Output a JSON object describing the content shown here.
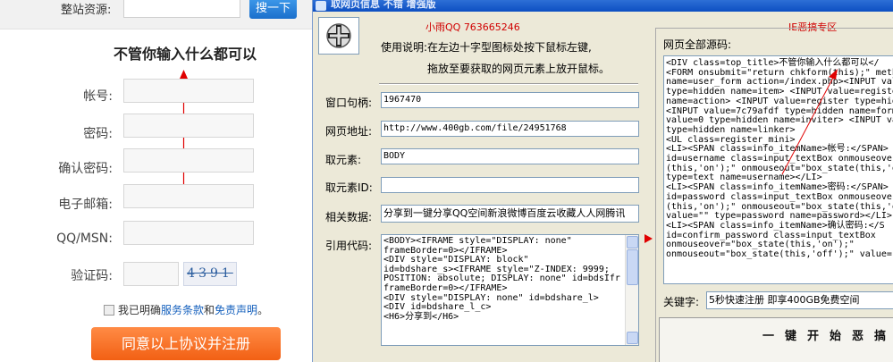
{
  "register_page": {
    "site_resource_label": "整站资源:",
    "search_button": "搜一下",
    "title": "不管你输入什么都可以",
    "fields": [
      {
        "label": "帐号:"
      },
      {
        "label": "密码:"
      },
      {
        "label": "确认密码:"
      },
      {
        "label": "电子邮箱:"
      },
      {
        "label": "QQ/MSN:"
      },
      {
        "label": "验证码:"
      }
    ],
    "captcha": "4391",
    "agree_prefix": "我已明确",
    "agree_terms": "服务条款",
    "agree_and": "和",
    "agree_disclaimer": "免责声明",
    "agree_end": "。",
    "submit": "同意以上协议并注册"
  },
  "tool": {
    "title": "取网页信息 不错 增强版",
    "qq_header": "小雨QQ  763665246",
    "ie_header": "IE恶搞专区",
    "usage_line1": "使用说明:在左边十字型图标处按下鼠标左键,",
    "usage_line2": "拖放至要获取的网页元素上放开鼠标。",
    "window_handle_label": "窗口句柄:",
    "window_handle_value": "1967470",
    "url_label": "网页地址:",
    "url_value": "http://www.400gb.com/file/24951768",
    "element_label": "取元素:",
    "element_value": "BODY",
    "element_id_label": "取元素ID:",
    "element_id_value": "",
    "related_label": "相关数据:",
    "related_value": "分享到一键分享QQ空间新浪微博百度云收藏人人网腾讯",
    "ref_code_label": "引用代码:",
    "ref_code": "<BODY><IFRAME style=\"DISPLAY: none\"\nframeBorder=0></IFRAME>\n<DIV style=\"DISPLAY: block\"\nid=bdshare_s><IFRAME style=\"Z-INDEX: 9999;\nPOSITION: absolute; DISPLAY: none\" id=bdsIfr\nframeBorder=0></IFRAME>\n<DIV style=\"DISPLAY: none\" id=bdshare_l>\n<DIV id=bdshare_l_c>\n<H6>分享到</H6>",
    "source_label": "网页全部源码:",
    "source_code": "<DIV class=top_title>不管你输入什么都可以</\n<FORM onsubmit=\"return chkform(this);\" meth\nname=user_form action=/index.php><INPUT val\ntype=hidden name=item> <INPUT value=registe\nname=action> <INPUT value=register type=hid\n<INPUT value=7c79afdf type=hidden name=form\nvalue=0 type=hidden name=inviter> <INPUT va\ntype=hidden name=linker>\n<UL class=register_mini>\n<LI><SPAN class=info_itemName>帐号:</SPAN>\nid=username class=input_textBox onmouseover\n(this,'on');\" onmouseout=\"box_state(this,'o\ntype=text name=username></LI>\n<LI><SPAN class=info_itemName>密码:</SPAN>\nid=password class=input_textBox onmouseover\n(this,'on');\" onmouseout=\"box_state(this,'o\nvalue=\"\" type=password name=password></LI>\n<LI><SPAN class=info_itemName>确认密码:</S\nid=confirm_password class=input_textBox\nonmouseover=\"box_state(this,'on');\"\nonmouseout=\"box_state(this,'off');\" value=\"",
    "keyword_label": "关键字:",
    "keyword_value": "5秒快速注册 即享400GB免费空间",
    "onekey_button": "一键开始恶搞"
  },
  "colors": {
    "annotation_red": "#e00000",
    "title_blue": "#0d4fc2",
    "submit_orange": "#f26014"
  }
}
